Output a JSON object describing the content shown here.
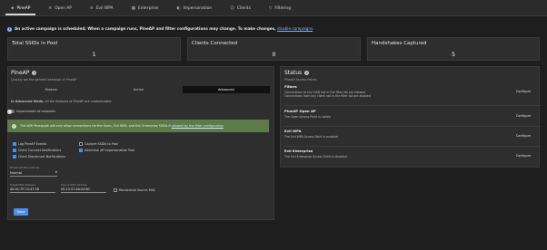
{
  "nav": {
    "tabs": [
      {
        "label": "PineAP",
        "icon": "pineapple-icon"
      },
      {
        "label": "Open AP",
        "icon": "wifi-icon"
      },
      {
        "label": "Evil WPA",
        "icon": "wifi-lock-icon"
      },
      {
        "label": "Enterprise",
        "icon": "building-icon"
      },
      {
        "label": "Impersonation",
        "icon": "mask-icon"
      },
      {
        "label": "Clients",
        "icon": "people-icon"
      },
      {
        "label": "Filtering",
        "icon": "filter-icon"
      }
    ],
    "active_index": 0
  },
  "banner": {
    "strong": "An active campaign is scheduled; When a campaign runs, PineAP and filter configurations may change. To make changes,",
    "link": "disable campaigns"
  },
  "stats": [
    {
      "label": "Total SSIDs in Pool",
      "value": "1"
    },
    {
      "label": "Clients Connected",
      "value": "0"
    },
    {
      "label": "Handshakes Captured",
      "value": "5"
    }
  ],
  "pineap": {
    "title": "PineAP",
    "subtitle": "Quickly set the general behavior of PineAP",
    "modes": [
      "Passive",
      "Active",
      "Advanced"
    ],
    "selected_mode": "Advanced",
    "advanced_note_bold": "In Advanced Mode,",
    "advanced_note": "all the features of PineAP are customizable.",
    "toggle_label": "Impersonate all networks",
    "alert_text": "The WiFi Pineapple will only allow connections for the Open, Evil WPA, and Evil Enterprise SSIDs if",
    "alert_link": "allowed by the filter configuration",
    "checkboxes_left": [
      {
        "label": "Log PineAP Events",
        "checked": true
      },
      {
        "label": "Client Connect Notifications",
        "checked": true
      },
      {
        "label": "Client Disconnect Notifications",
        "checked": true
      }
    ],
    "checkboxes_right": [
      {
        "label": "Capture SSIDs to Pool",
        "checked": false
      },
      {
        "label": "Advertise AP Impersonation Pool",
        "checked": true
      }
    ],
    "broadcast_label": "Broadcast Pool Interval",
    "broadcast_value": "Normal",
    "target_mac_label": "Target MAC Address",
    "target_mac_value": "AE:01:7E:74:47:3B",
    "source_mac_label": "Source MAC Address",
    "source_mac_value": "00:13:37:AA:A9:6C",
    "randomize_label": "Randomize Source MAC",
    "randomize_checked": false,
    "save_label": "Save"
  },
  "status": {
    "title": "Status",
    "subtitle": "PineAP Access Points",
    "rows": [
      {
        "title": "Filters",
        "lines": [
          "Connections to any SSID not in the filter list are allowed",
          "Connections from any client not in the filter list are allowed"
        ],
        "action": "Configure"
      },
      {
        "title": "PineAP Open AP",
        "lines": [
          "The Open Access Point is visible"
        ],
        "action": "Configure"
      },
      {
        "title": "Evil WPA",
        "lines": [
          "The Evil WPA Access Point is enabled"
        ],
        "action": "Configure"
      },
      {
        "title": "Evil Enterprise",
        "lines": [
          "The Evil Enterprise Access Point is disabled"
        ],
        "action": "Configure"
      }
    ]
  },
  "colors": {
    "background": "#1e1e1e",
    "card": "#2e2e2e",
    "accent": "#4a8ff0",
    "alert_green": "#5c7a4a"
  }
}
